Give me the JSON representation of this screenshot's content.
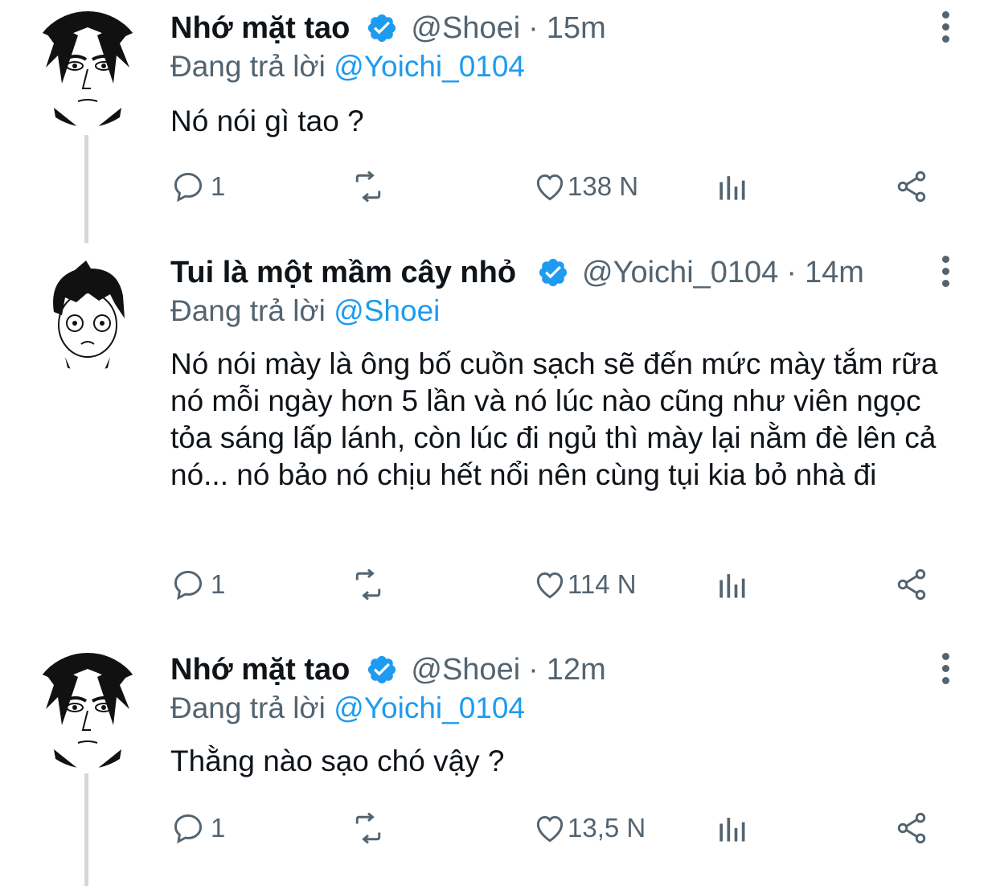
{
  "tweets": [
    {
      "name": "Nhớ mặt tao",
      "handle": "@Shoei",
      "sep": "·",
      "time": "15m",
      "reply_prefix": "Đang trả lời ",
      "reply_to": "@Yoichi_0104",
      "text": "Nó nói gì tao ?",
      "replies": "1",
      "likes": "138 N",
      "avatar": "shoei-avatar"
    },
    {
      "name": "Tui là một mầm cây nhỏ",
      "handle": "@Yoichi_0104",
      "sep": "·",
      "time": "14m",
      "reply_prefix": "Đang trả lời ",
      "reply_to": "@Shoei",
      "text": "Nó nói mày là ông bố cuồn sạch sẽ đến mức mày tắm rữa nó mỗi ngày hơn 5 lần và nó lúc nào cũng như viên ngọc tỏa sáng lấp lánh, còn lúc đi ngủ thì mày lại nằm đè lên cả nó... nó bảo nó chịu hết nổi nên cùng tụi kia bỏ nhà đi",
      "replies": "1",
      "likes": "114 N",
      "avatar": "yoichi-avatar"
    },
    {
      "name": "Nhớ mặt tao",
      "handle": "@Shoei",
      "sep": "·",
      "time": "12m",
      "reply_prefix": "Đang trả lời ",
      "reply_to": "@Yoichi_0104",
      "text": "Thằng nào sạo chó vậy ?",
      "replies": "1",
      "likes": "13,5 N",
      "avatar": "shoei-avatar"
    }
  ],
  "icons": {
    "reply": "reply-icon",
    "retweet": "retweet-icon",
    "like": "heart-icon",
    "views": "views-icon",
    "share": "share-icon",
    "more": "more-icon",
    "verified": "verified-badge-icon"
  },
  "colors": {
    "accent": "#1d9bf0",
    "muted": "#536471",
    "text": "#0f1419",
    "thread_line": "#d3d6da"
  }
}
